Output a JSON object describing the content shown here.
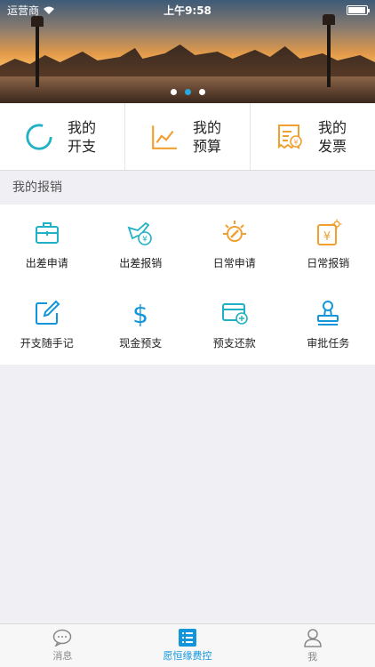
{
  "status": {
    "carrier": "运营商",
    "time": "上午9:58"
  },
  "banner": {
    "slides": 3,
    "active_slide": 2
  },
  "summary": [
    {
      "label": "我的开支",
      "icon": "circle-progress-icon"
    },
    {
      "label": "我的预算",
      "icon": "line-chart-icon"
    },
    {
      "label": "我的发票",
      "icon": "receipt-icon"
    }
  ],
  "section": {
    "title": "我的报销"
  },
  "grid": [
    {
      "label": "出差申请",
      "icon": "briefcase-icon"
    },
    {
      "label": "出差报销",
      "icon": "plane-yen-icon"
    },
    {
      "label": "日常申请",
      "icon": "sun-pen-icon"
    },
    {
      "label": "日常报销",
      "icon": "yen-doc-icon"
    },
    {
      "label": "开支随手记",
      "icon": "edit-note-icon"
    },
    {
      "label": "现金预支",
      "icon": "dollar-icon"
    },
    {
      "label": "预支还款",
      "icon": "card-refund-icon"
    },
    {
      "label": "审批任务",
      "icon": "stamp-icon"
    }
  ],
  "tabs": [
    {
      "label": "消息",
      "icon": "chat-bubble-icon",
      "active": false
    },
    {
      "label": "愿恒缘费控",
      "icon": "list-icon",
      "active": true
    },
    {
      "label": "我",
      "icon": "person-icon",
      "active": false
    }
  ],
  "colors": {
    "teal": "#20b2c4",
    "orange": "#f0a030",
    "blue": "#1296db"
  }
}
